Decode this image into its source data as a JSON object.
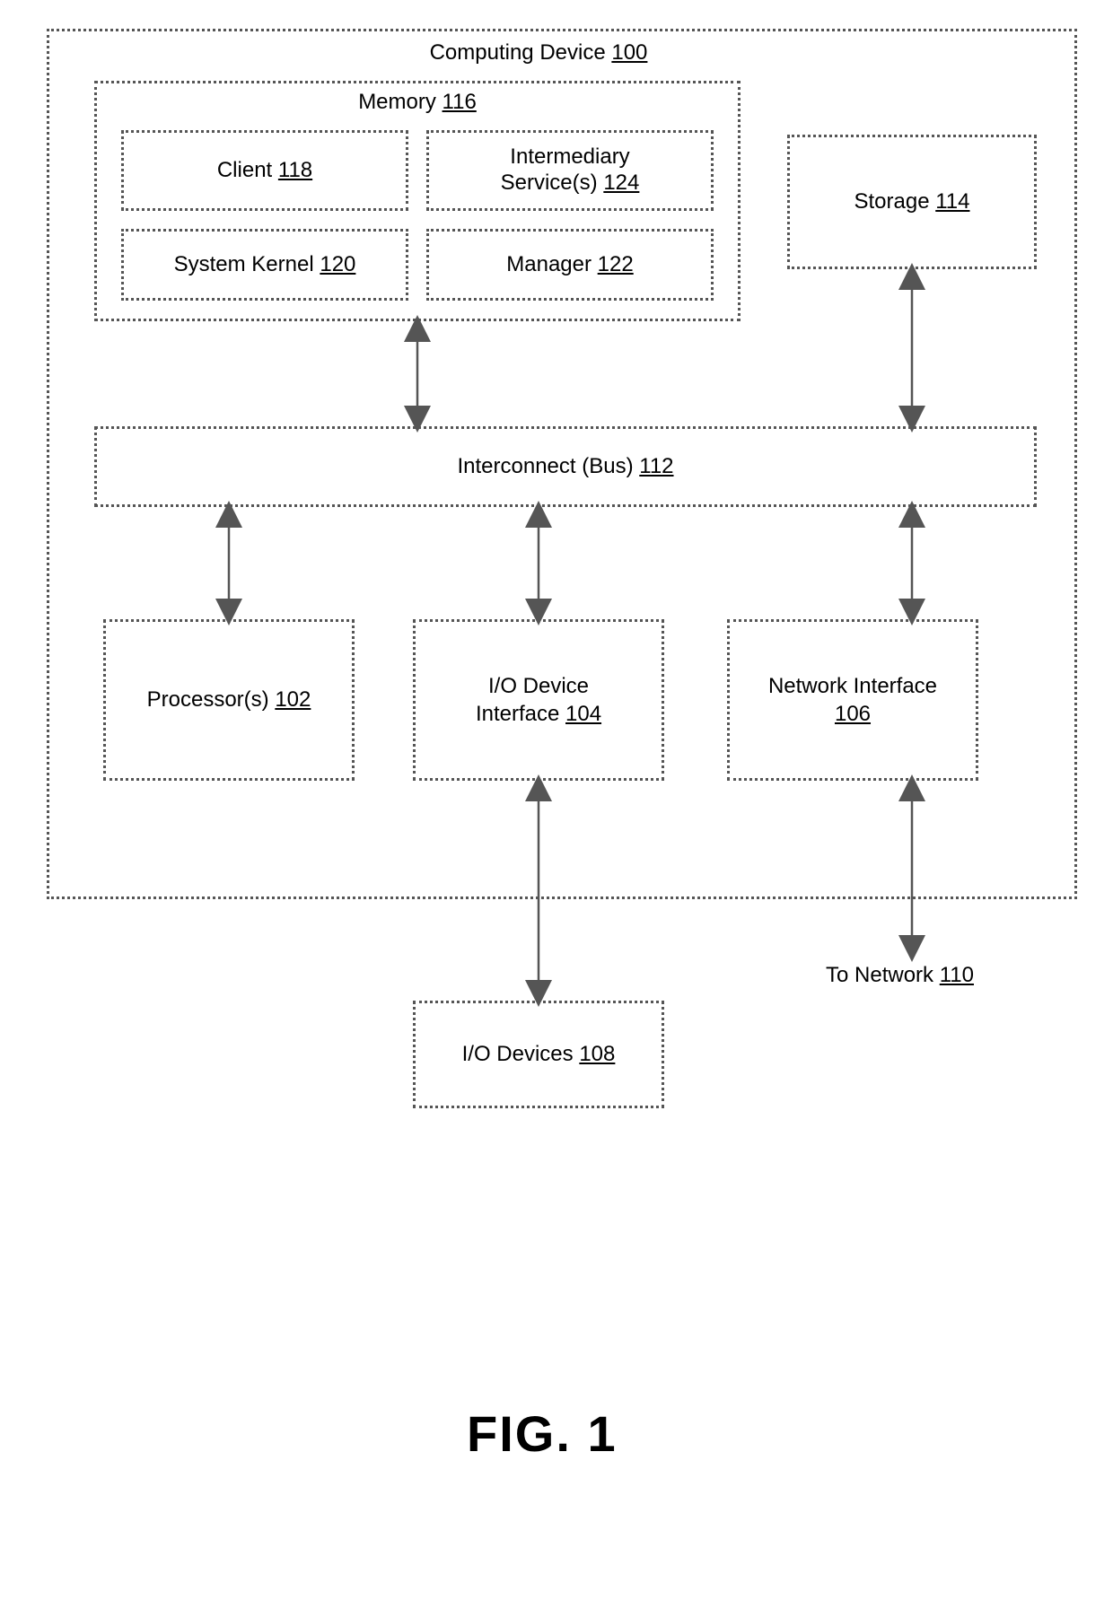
{
  "device": {
    "label": "Computing Device",
    "num": "100"
  },
  "memory": {
    "label": "Memory",
    "num": "116"
  },
  "client": {
    "label": "Client",
    "num": "118"
  },
  "kernel": {
    "label": "System Kernel",
    "num": "120"
  },
  "intermediary": {
    "line1": "Intermediary",
    "line2": "Service(s)",
    "num": "124"
  },
  "manager": {
    "label": "Manager",
    "num": "122"
  },
  "storage": {
    "label": "Storage",
    "num": "114"
  },
  "bus": {
    "label": "Interconnect (Bus)",
    "num": "112"
  },
  "processor": {
    "label": "Processor(s)",
    "num": "102"
  },
  "iointerface": {
    "line1": "I/O Device",
    "line2": "Interface",
    "num": "104"
  },
  "netinterface": {
    "line1": "Network Interface",
    "num": "106"
  },
  "iodevices": {
    "label": "I/O Devices",
    "num": "108"
  },
  "tonetwork": {
    "label": "To Network",
    "num": "110"
  },
  "figcaption": "FIG. 1"
}
